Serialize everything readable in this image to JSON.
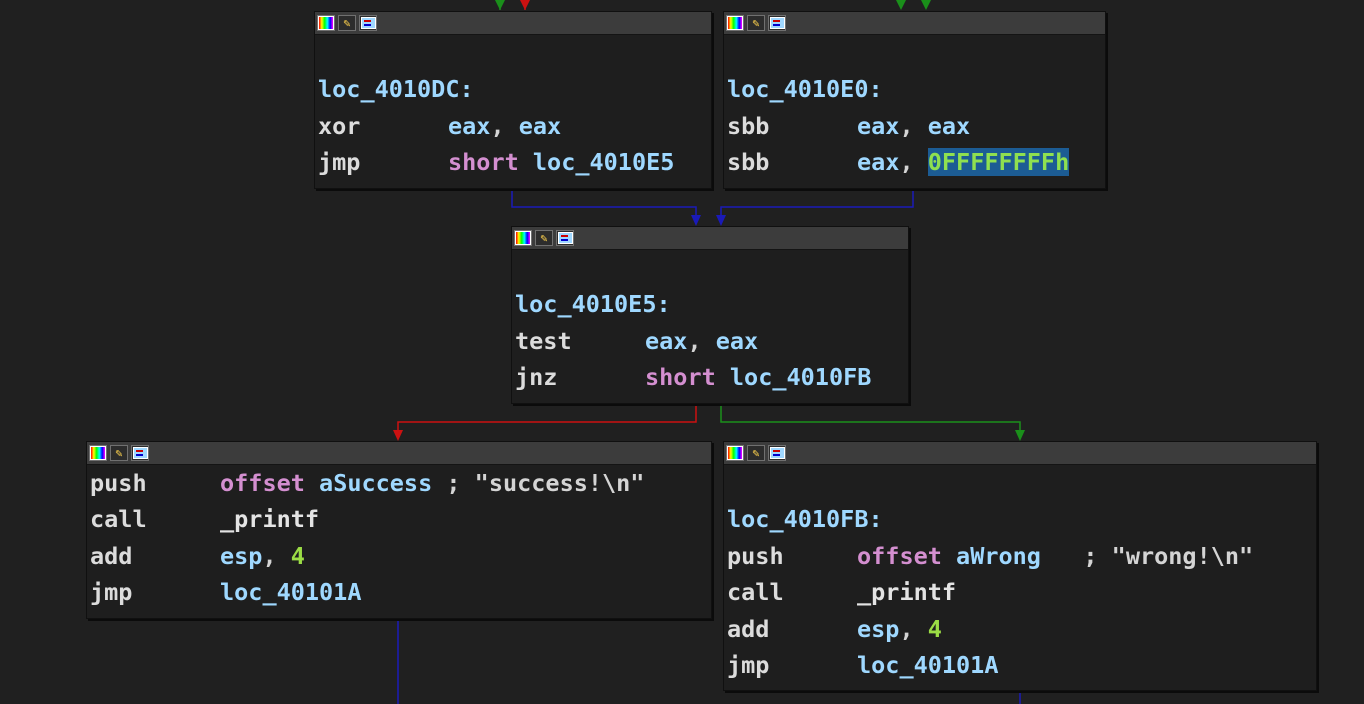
{
  "colors": {
    "background": "#202020",
    "edge_true": "#1a8f1a",
    "edge_false": "#cc1111",
    "edge_uncond": "#1a1ab8",
    "selection": "#1c5c94"
  },
  "nodes": {
    "n1": {
      "label": "loc_4010DC:",
      "lines": [
        {
          "mnem": "xor",
          "op1": "eax",
          "sep": ", ",
          "op2": "eax"
        },
        {
          "mnem": "jmp",
          "kw": "short",
          "target": "loc_4010E5"
        }
      ]
    },
    "n2": {
      "label": "loc_4010E0:",
      "lines": [
        {
          "mnem": "sbb",
          "op1": "eax",
          "sep": ", ",
          "op2": "eax"
        },
        {
          "mnem": "sbb",
          "op1": "eax",
          "sep": ", ",
          "imm": "0FFFFFFFFh"
        }
      ]
    },
    "n3": {
      "label": "loc_4010E5:",
      "lines": [
        {
          "mnem": "test",
          "op1": "eax",
          "sep": ", ",
          "op2": "eax"
        },
        {
          "mnem": "jnz",
          "kw": "short",
          "target": "loc_4010FB"
        }
      ]
    },
    "n4": {
      "lines": [
        {
          "mnem": "push",
          "kw": "offset",
          "target": "aSuccess",
          "comment": " ; \"success!\\n\""
        },
        {
          "mnem": "call",
          "target": "_printf"
        },
        {
          "mnem": "add",
          "op1": "esp",
          "sep": ", ",
          "imm": "4"
        },
        {
          "mnem": "jmp",
          "target": "loc_40101A"
        }
      ]
    },
    "n5": {
      "label": "loc_4010FB:",
      "lines": [
        {
          "mnem": "push",
          "kw": "offset",
          "target": "aWrong",
          "comment": "   ; \"wrong!\\n\""
        },
        {
          "mnem": "call",
          "target": "_printf"
        },
        {
          "mnem": "add",
          "op1": "esp",
          "sep": ", ",
          "imm": "4"
        },
        {
          "mnem": "jmp",
          "target": "loc_40101A"
        }
      ]
    }
  },
  "toolbar_icons": [
    "palette-icon",
    "edit-node-icon",
    "graph-overview-icon"
  ]
}
